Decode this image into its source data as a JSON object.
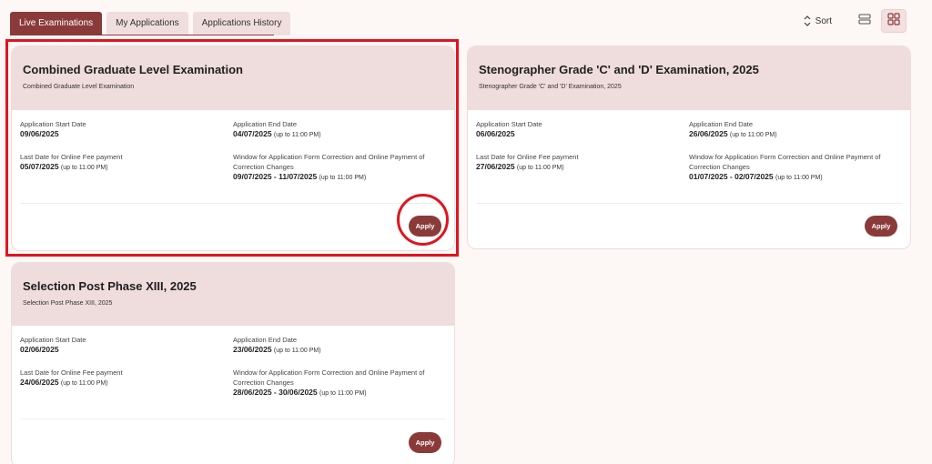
{
  "tabs": [
    {
      "label": "Live Examinations",
      "active": true
    },
    {
      "label": "My Applications",
      "active": false
    },
    {
      "label": "Applications History",
      "active": false
    }
  ],
  "toolbar": {
    "sort_label": "Sort"
  },
  "cards": [
    {
      "title": "Combined Graduate Level Examination",
      "subtitle": "Combined Graduate Level Examination",
      "start_label": "Application Start Date",
      "start_value": "09/06/2025",
      "end_label": "Application End Date",
      "end_value": "04/07/2025",
      "end_note": "(up to 11:00 PM)",
      "fee_label": "Last Date for Online Fee payment",
      "fee_value": "05/07/2025",
      "fee_note": "(up to 11:00 PM)",
      "window_label": "Window for Application Form Correction and Online Payment of Correction Changes",
      "window_value": "09/07/2025 - 11/07/2025",
      "window_note": "(up to 11:00 PM)",
      "apply_label": "Apply"
    },
    {
      "title": "Stenographer Grade 'C' and 'D' Examination, 2025",
      "subtitle": "Stenographer Grade 'C' and 'D' Examination, 2025",
      "start_label": "Application Start Date",
      "start_value": "06/06/2025",
      "end_label": "Application End Date",
      "end_value": "26/06/2025",
      "end_note": "(up to 11:00 PM)",
      "fee_label": "Last Date for Online Fee payment",
      "fee_value": "27/06/2025",
      "fee_note": "(up to 11:00 PM)",
      "window_label": "Window for Application Form Correction and Online Payment of Correction Changes",
      "window_value": "01/07/2025 - 02/07/2025",
      "window_note": "(up to 11:00 PM)",
      "apply_label": "Apply"
    },
    {
      "title": "Selection Post Phase XIII, 2025",
      "subtitle": "Selection Post Phase XIII, 2025",
      "start_label": "Application Start Date",
      "start_value": "02/06/2025",
      "end_label": "Application End Date",
      "end_value": "23/06/2025",
      "end_note": "(up to 11:00 PM)",
      "fee_label": "Last Date for Online Fee payment",
      "fee_value": "24/06/2025",
      "fee_note": "(up to 11:00 PM)",
      "window_label": "Window for Application Form Correction and Online Payment of Correction Changes",
      "window_value": "28/06/2025 - 30/06/2025",
      "window_note": "(up to 11:00 PM)",
      "apply_label": "Apply"
    }
  ],
  "colors": {
    "accent": "#8b3a3a",
    "card_header": "#efdcdc",
    "highlight": "#e0141e"
  }
}
